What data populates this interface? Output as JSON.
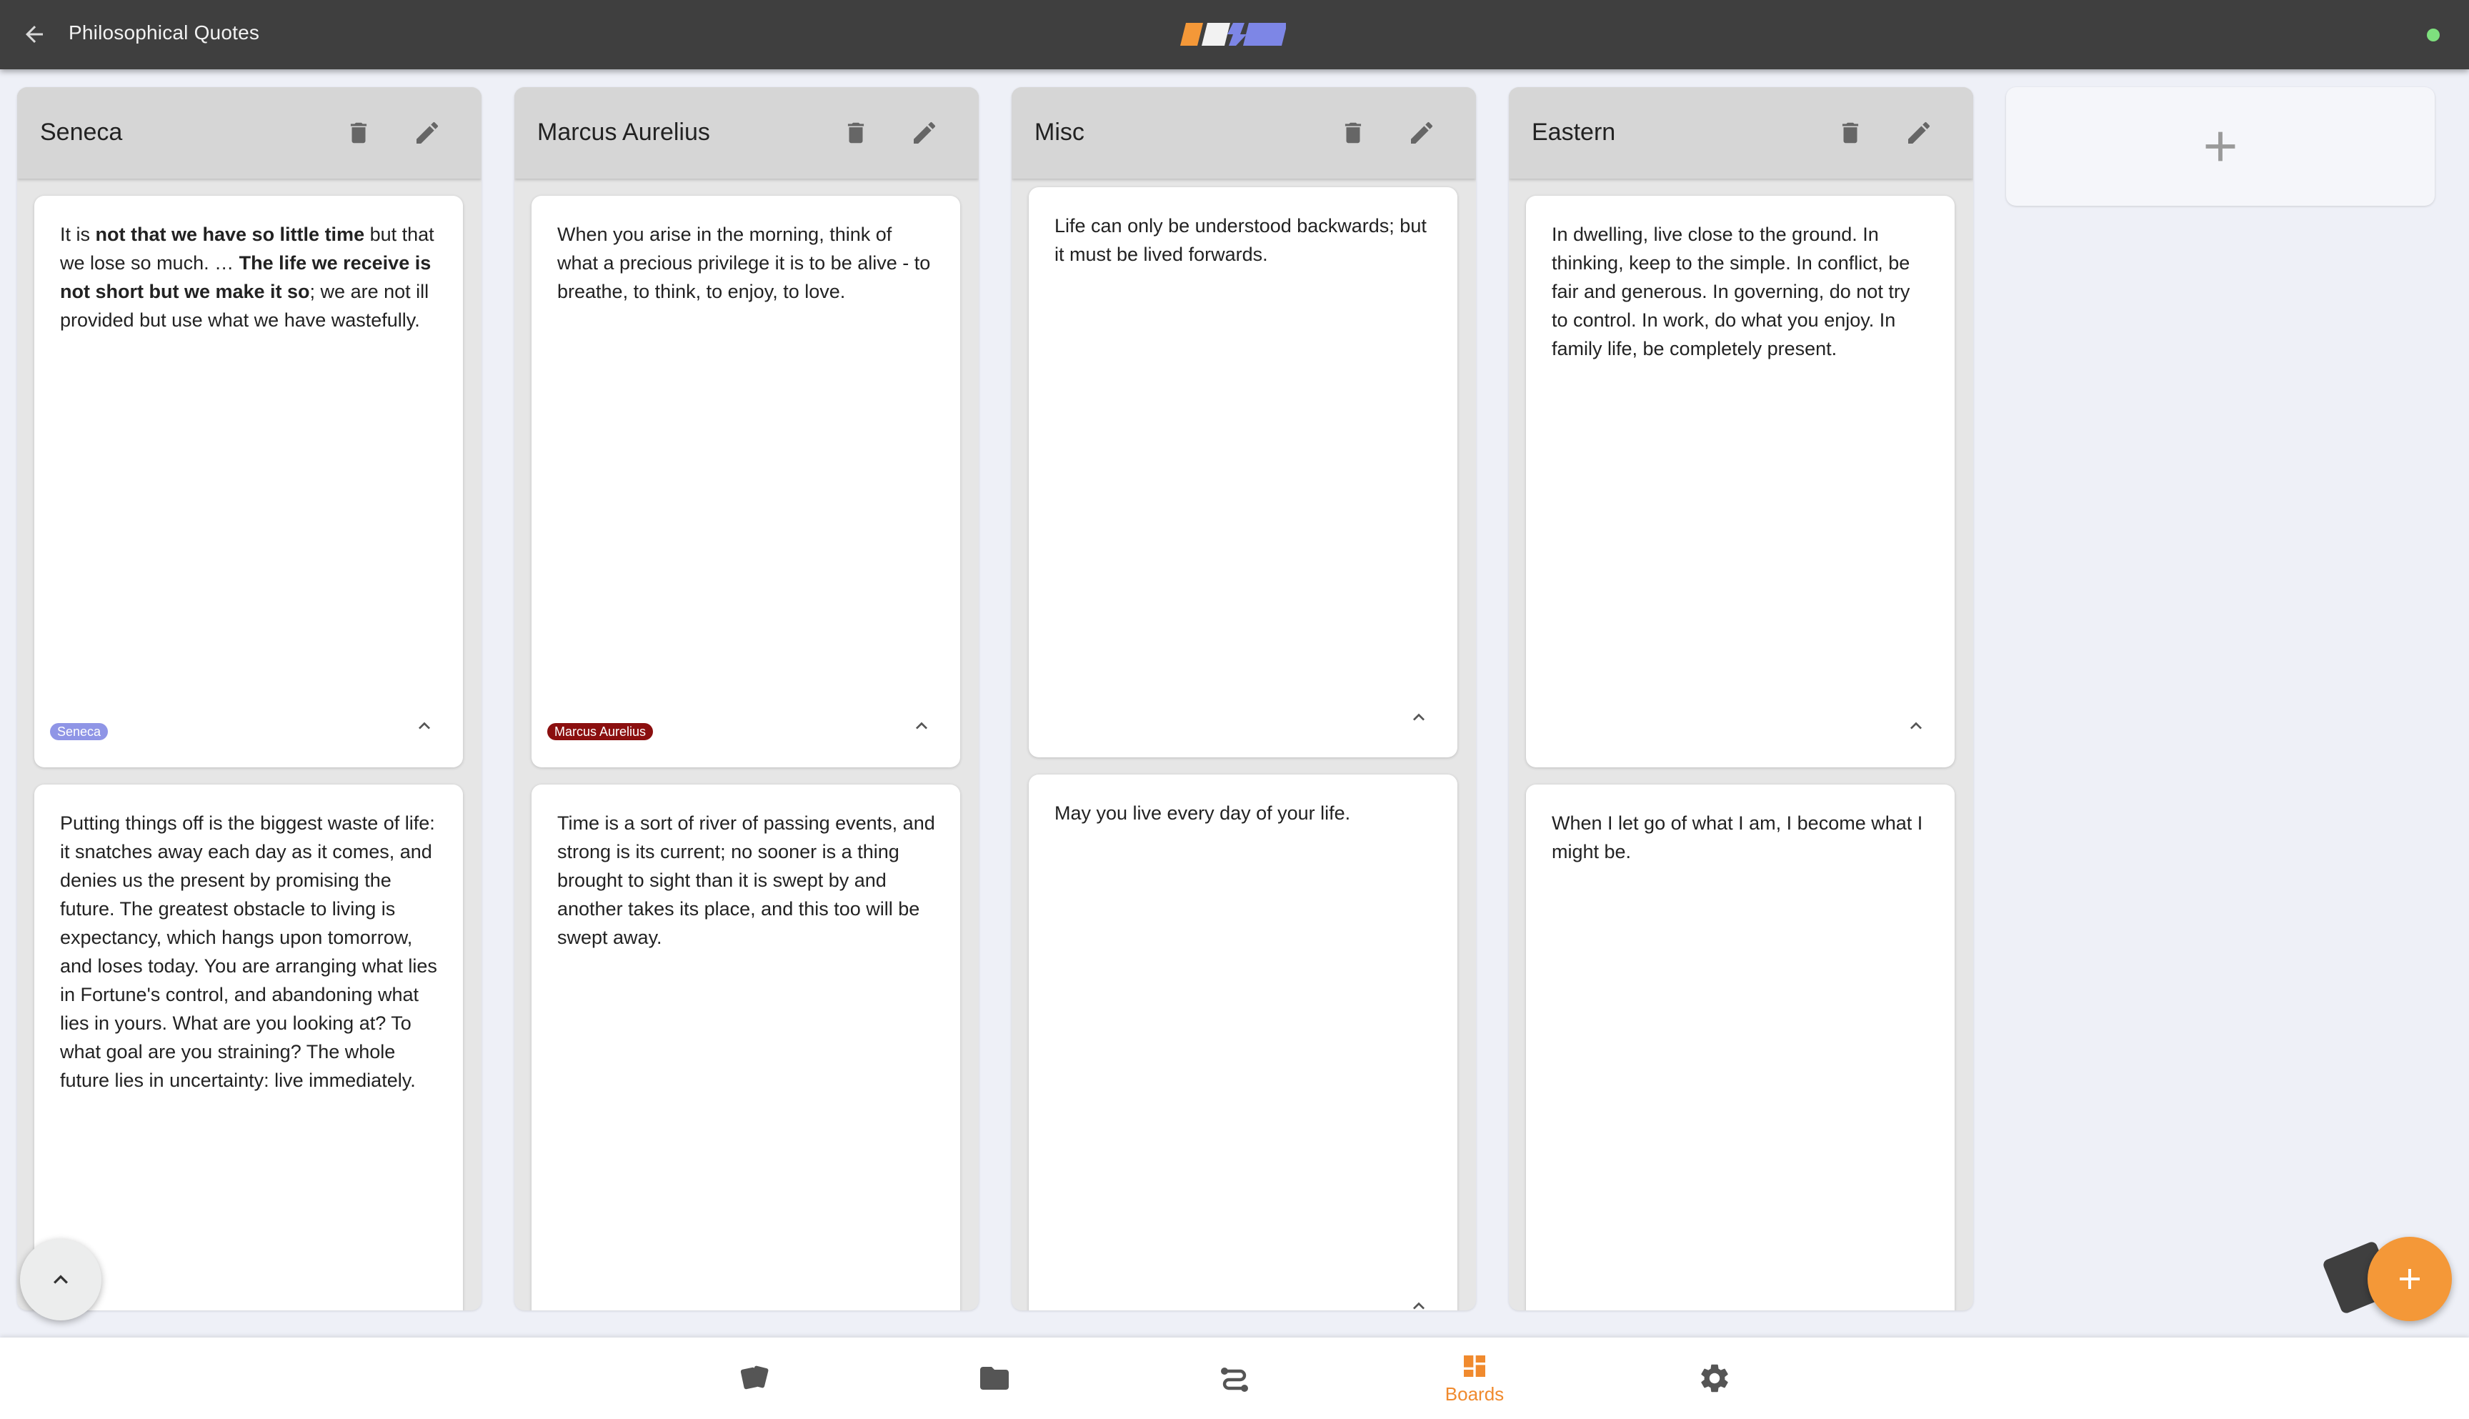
{
  "header": {
    "title": "Philosophical Quotes",
    "back_icon": "arrow-left-icon",
    "status_color": "#7ee07e"
  },
  "colors": {
    "accent": "#f49838",
    "topbar": "#3f3f3f",
    "column_bg": "#e6e6e6",
    "column_header": "#d6d6d6",
    "tag_seneca": "#8f95e6",
    "tag_marcus": "#8b0f0f"
  },
  "columns": [
    {
      "title": "Seneca",
      "cards": [
        {
          "segments": [
            {
              "text": "It is ",
              "bold": false
            },
            {
              "text": "not that we have so little time",
              "bold": true
            },
            {
              "text": " but that we lose so much. … ",
              "bold": false
            },
            {
              "text": "The life we receive is not short but we make it so",
              "bold": true
            },
            {
              "text": "; we are not ill provided but use what we have wastefully.",
              "bold": false
            }
          ],
          "tag": "Seneca"
        },
        {
          "segments": [
            {
              "text": "Putting things off is the biggest waste of life: it snatches away each day as it comes, and denies us the present by promising the future. The greatest obstacle to living is expectancy, which hangs upon tomorrow, and loses today. You are arranging what lies in Fortune's control, and abandoning what lies in yours. What are you looking at? To what goal are you straining? The whole future lies in uncertainty: live immediately.",
              "bold": false
            }
          ]
        }
      ]
    },
    {
      "title": "Marcus Aurelius",
      "cards": [
        {
          "segments": [
            {
              "text": "When you arise in the morning, think of what a precious privilege it is to be alive - to breathe, to think, to enjoy, to love.",
              "bold": false
            }
          ],
          "tag": "Marcus Aurelius"
        },
        {
          "segments": [
            {
              "text": "Time is a sort of river of passing events, and strong is its current; no sooner is a thing brought to sight than it is swept by and another takes its place, and this too will be swept away.",
              "bold": false
            }
          ]
        }
      ]
    },
    {
      "title": "Misc",
      "cards": [
        {
          "segments": [
            {
              "text": "Life can only be understood backwards; but it must be lived forwards.",
              "bold": false
            }
          ]
        },
        {
          "segments": [
            {
              "text": "May you live every day of your life.",
              "bold": false
            }
          ]
        }
      ]
    },
    {
      "title": "Eastern",
      "cards": [
        {
          "segments": [
            {
              "text": "In dwelling, live close to the ground.  In thinking, keep to the simple.  In conflict, be fair and generous.  In governing, do not try to control.  In work, do what you enjoy.  In family life, be completely present.",
              "bold": false
            }
          ]
        },
        {
          "segments": [
            {
              "text": "When I let go of what I am, I become what I might be.",
              "bold": false
            }
          ]
        }
      ]
    }
  ],
  "add_column_icon": "plus-icon",
  "bottom_nav": [
    {
      "icon": "cards-icon",
      "label": ""
    },
    {
      "icon": "folder-icon",
      "label": ""
    },
    {
      "icon": "flow-icon",
      "label": ""
    },
    {
      "icon": "boards-icon",
      "label": "Boards",
      "active": true
    },
    {
      "icon": "gear-icon",
      "label": ""
    }
  ]
}
